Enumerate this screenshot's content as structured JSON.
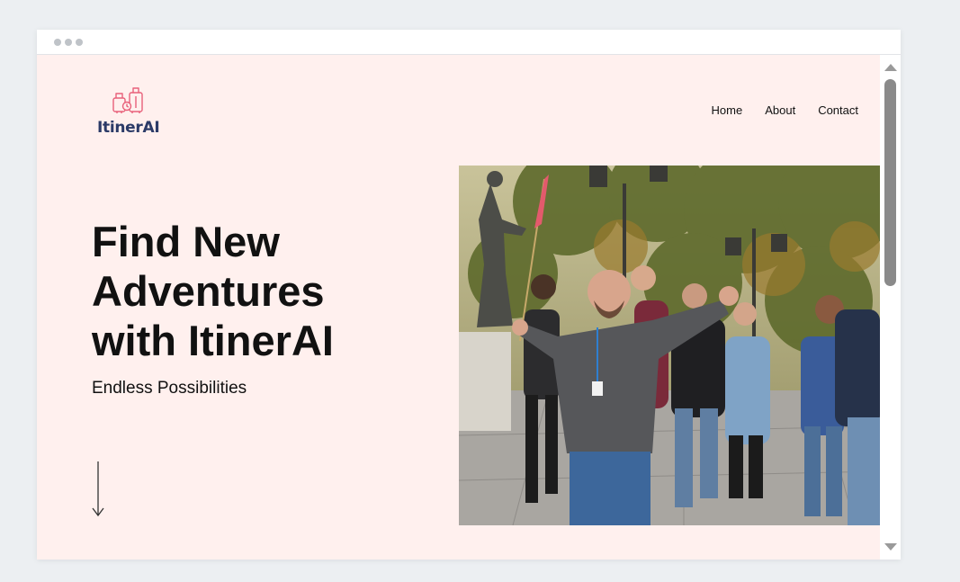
{
  "window": {
    "chrome_dots": 3
  },
  "brand": {
    "name": "ItinerAI",
    "icon": "luggage-icon"
  },
  "nav": {
    "items": [
      "Home",
      "About",
      "Contact"
    ]
  },
  "hero": {
    "title": "Find New Adventures with ItinerAI",
    "subtitle": "Endless Possibilities",
    "scroll_icon": "arrow-down-icon",
    "image_icon": "hero-photo"
  },
  "colors": {
    "page_bg": "#fff0ee",
    "brand_text": "#2b3a67",
    "logo_accent": "#e8607a",
    "text": "#111111"
  }
}
